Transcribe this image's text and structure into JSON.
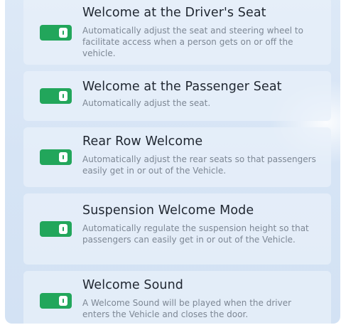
{
  "colors": {
    "toggle_on": "#22a65b",
    "title_text": "#1f2630",
    "description_text": "#7d8794",
    "panel_background": "#d8e5f5"
  },
  "settings": [
    {
      "title": "Welcome at the Driver's Seat",
      "description": "Automatically adjust the seat and steering wheel to facilitate access when a person gets on or off the vehicle.",
      "enabled": true
    },
    {
      "title": "Welcome at the Passenger Seat",
      "description": "Automatically adjust the seat.",
      "enabled": true
    },
    {
      "title": "Rear Row Welcome",
      "description": "Automatically adjust the rear seats so that passengers easily get in or out of the Vehicle.",
      "enabled": true
    },
    {
      "title": "Suspension Welcome Mode",
      "description": "Automatically regulate the suspension height so that passengers can easily get in or out of the Vehicle.",
      "enabled": true
    },
    {
      "title": "Welcome Sound",
      "description": "A Welcome Sound will be played when the driver enters the Vehicle and closes the door.",
      "enabled": true
    }
  ]
}
